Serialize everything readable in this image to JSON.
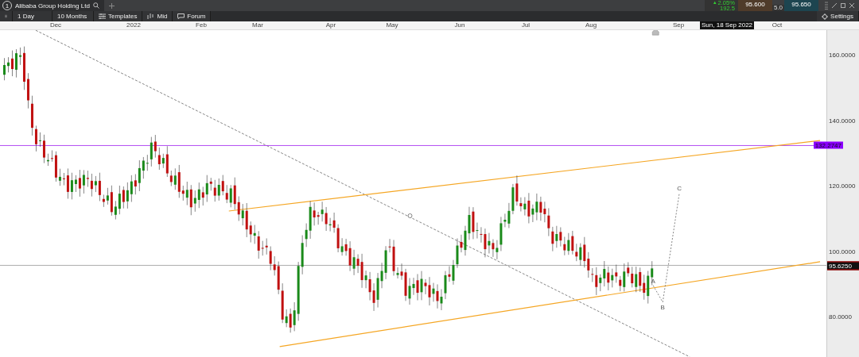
{
  "tab": {
    "number": "1",
    "title": "Alibaba Group Holding Ltd"
  },
  "quote": {
    "arrow": "▲",
    "change": "2.05%",
    "points": "192.5",
    "bid": "95.600",
    "ask": "95.650",
    "spread": "5.0"
  },
  "toolbar": {
    "interval": "1 Day",
    "range": "10 Months",
    "buttons": [
      {
        "kind": "templates",
        "label": "Templates"
      },
      {
        "kind": "mid",
        "label": "Mid"
      },
      {
        "kind": "forum",
        "label": "Forum"
      }
    ],
    "settings": "Settings"
  },
  "chart": {
    "x_labels": [
      "Dec",
      "2022",
      "Feb",
      "Mar",
      "Apr",
      "May",
      "Jun",
      "Jul",
      "Aug",
      "Sep",
      "Oct"
    ],
    "cursor_date": "Sun, 18 Sep 2022",
    "y_labels": [
      "160.0000",
      "140.0000",
      "120.0000",
      "100.0000",
      "80.0000"
    ],
    "level_tag": "132.2747",
    "price_tag": "95.6250",
    "wave_labels": [
      "A",
      "B",
      "C"
    ]
  }
}
